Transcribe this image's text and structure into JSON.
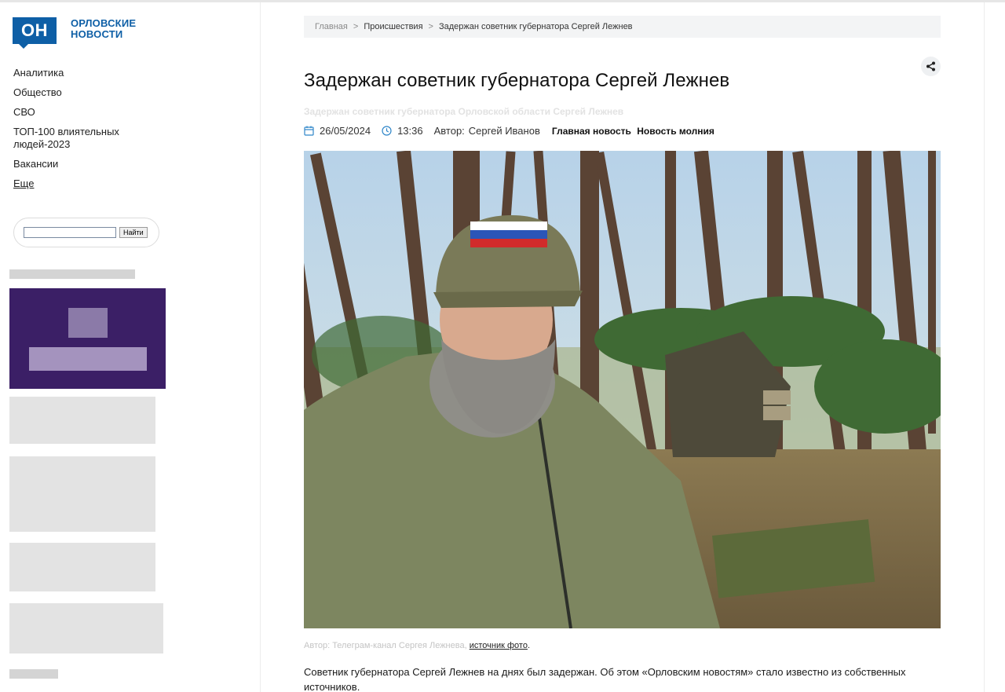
{
  "site": {
    "logo_badge": "ОН",
    "logo_text": "ОРЛОВСКИЕ НОВОСТИ",
    "brand_color": "#0e5fa6"
  },
  "sidebar": {
    "nav": [
      {
        "label": "Аналитика"
      },
      {
        "label": "Общество"
      },
      {
        "label": "СВО"
      },
      {
        "label": "ТОП-100 влиятельных людей-2023"
      },
      {
        "label": "Вакансии"
      },
      {
        "label": "Еще"
      }
    ],
    "search": {
      "value": "",
      "button_label": "Найти"
    }
  },
  "breadcrumb": {
    "home": "Главная",
    "separator": ">",
    "section": "Происшествия",
    "current": "Задержан советник губернатора Сергей Лежнев"
  },
  "article": {
    "title": "Задержан советник губернатора Сергей Лежнев",
    "subtitle": "Задержан советник губернатора Орловской области Сергей Лежнев",
    "date": "26/05/2024",
    "time": "13:36",
    "author_label": "Автор:",
    "author": "Сергей Иванов",
    "tags": [
      "Главная новость",
      "Новость молния"
    ],
    "photo_icon": "photo-selfie-forest",
    "caption_prefix": "Автор: Телеграм-канал Сергея Лежнева,",
    "caption_link": "источник фото",
    "caption_suffix": ".",
    "body": "Советник губернатора Сергей Лежнев на днях был задержан. Об этом «Орловским новостям» стало известно из собственных источников."
  },
  "icons": {
    "share": "share-icon",
    "calendar": "calendar-icon",
    "clock": "clock-icon"
  }
}
